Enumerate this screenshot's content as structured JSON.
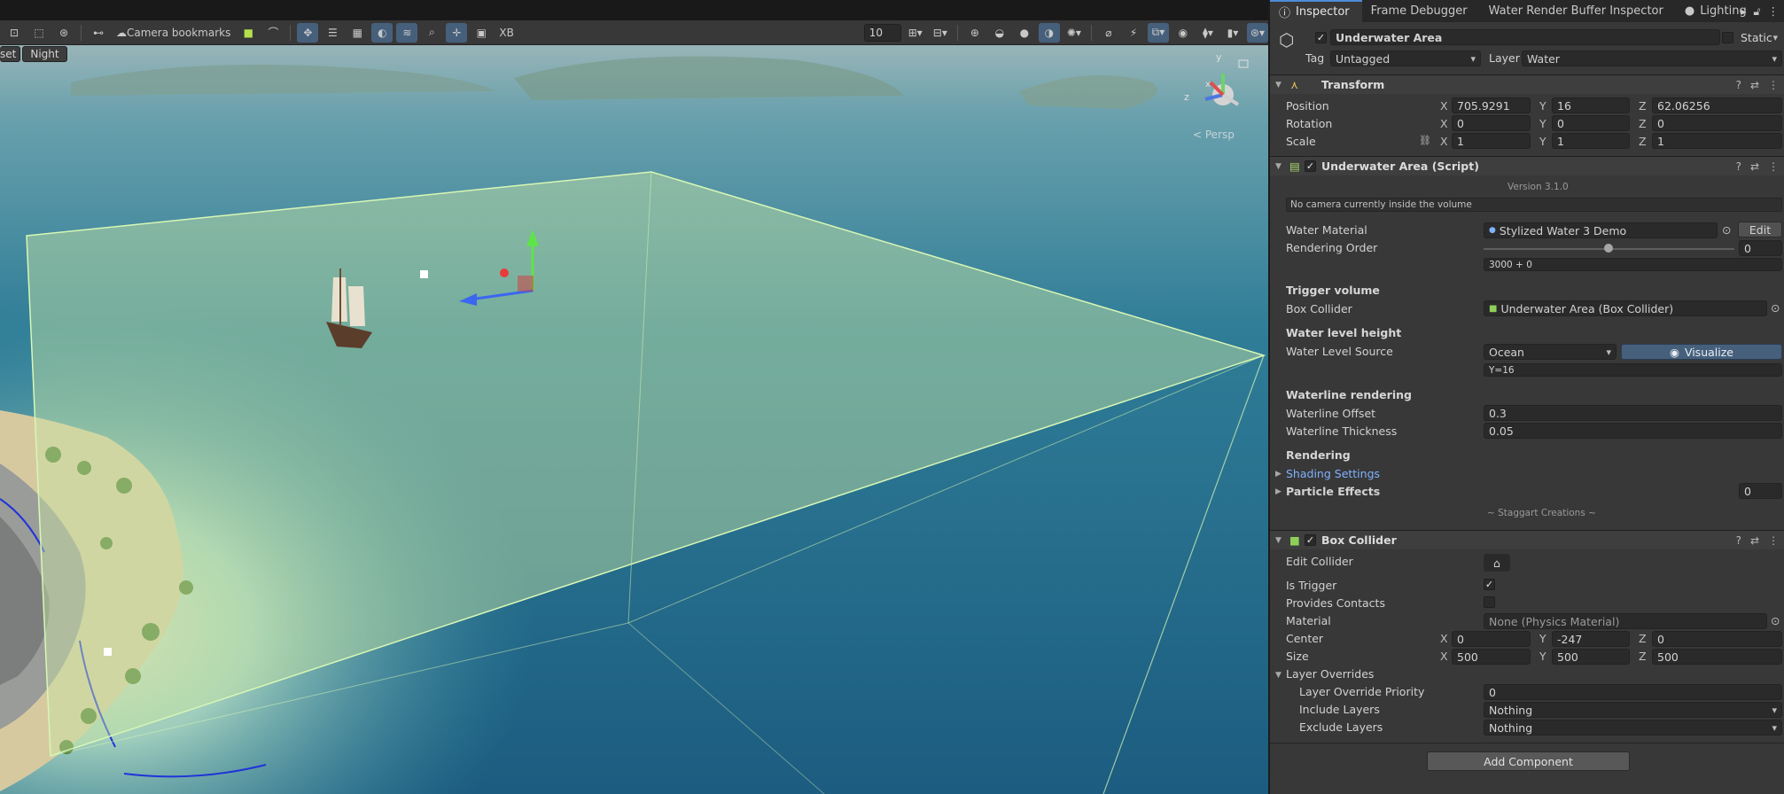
{
  "scene": {
    "toolbar": {
      "camera_bookmarks": "Camera bookmarks",
      "grid_size": "10",
      "xb_label": "XB"
    },
    "subbar": {
      "preset_label": "set",
      "night_label": "Night"
    },
    "gizmo": {
      "persp_label": "< Persp",
      "axis_x": "x",
      "axis_y": "y",
      "axis_z": "z"
    }
  },
  "inspector": {
    "tabs": [
      {
        "label": "Inspector"
      },
      {
        "label": "Frame Debugger"
      },
      {
        "label": "Water Render Buffer Inspector"
      },
      {
        "label": "Lighting"
      }
    ],
    "object": {
      "name": "Underwater Area",
      "static_label": "Static",
      "tag_label": "Tag",
      "tag_value": "Untagged",
      "layer_label": "Layer",
      "layer_value": "Water"
    },
    "transform": {
      "title": "Transform",
      "position_label": "Position",
      "rotation_label": "Rotation",
      "scale_label": "Scale",
      "position": {
        "x": "705.9291",
        "y": "16",
        "z": "62.06256"
      },
      "rotation": {
        "x": "0",
        "y": "0",
        "z": "0"
      },
      "scale": {
        "x": "1",
        "y": "1",
        "z": "1"
      }
    },
    "underwater_script": {
      "title": "Underwater Area (Script)",
      "version": "Version 3.1.0",
      "help_text": "No camera currently inside the volume",
      "water_material_label": "Water Material",
      "water_material_value": "Stylized Water 3 Demo",
      "edit_label": "Edit",
      "rendering_order_label": "Rendering Order",
      "rendering_order_value": "0",
      "rendering_order_note": "3000 + 0",
      "rendering_order_fraction": 0.5,
      "trigger_volume_title": "Trigger volume",
      "box_collider_label": "Box Collider",
      "box_collider_value": "Underwater Area (Box Collider)",
      "water_level_title": "Water level height",
      "water_level_source_label": "Water Level Source",
      "water_level_source_value": "Ocean",
      "visualize_label": "Visualize",
      "water_level_note": "Y=16",
      "waterline_title": "Waterline rendering",
      "waterline_offset_label": "Waterline Offset",
      "waterline_offset_value": "0.3",
      "waterline_thickness_label": "Waterline Thickness",
      "waterline_thickness_value": "0.05",
      "rendering_title": "Rendering",
      "shading_settings_label": "Shading Settings",
      "particle_effects_label": "Particle Effects",
      "particle_effects_value": "0",
      "credits": "~ Staggart Creations ~"
    },
    "box_collider": {
      "title": "Box Collider",
      "edit_collider_label": "Edit Collider",
      "is_trigger_label": "Is Trigger",
      "provides_contacts_label": "Provides Contacts",
      "material_label": "Material",
      "material_value": "None (Physics Material)",
      "center_label": "Center",
      "center": {
        "x": "0",
        "y": "-247",
        "z": "0"
      },
      "size_label": "Size",
      "size": {
        "x": "500",
        "y": "500",
        "z": "500"
      },
      "layer_overrides_label": "Layer Overrides",
      "layer_override_priority_label": "Layer Override Priority",
      "layer_override_priority_value": "0",
      "include_layers_label": "Include Layers",
      "include_layers_value": "Nothing",
      "exclude_layers_label": "Exclude Layers",
      "exclude_layers_value": "Nothing"
    },
    "add_component_label": "Add Component",
    "axis": {
      "x": "X",
      "y": "Y",
      "z": "Z"
    }
  },
  "colors": {
    "accent": "#46607c",
    "selection_box": "#c9e6a4",
    "link": "#7fb2ff"
  }
}
